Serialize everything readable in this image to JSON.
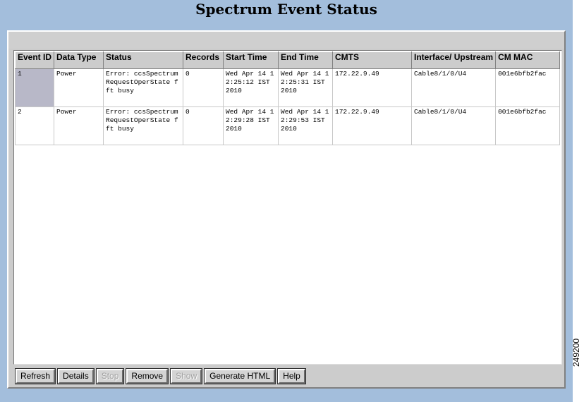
{
  "title": "Spectrum Event Status",
  "table": {
    "headers": [
      "Event ID",
      "Data Type",
      "Status",
      "Records",
      "Start Time",
      "End Time",
      "CMTS",
      "Interface/ Upstream",
      "CM MAC"
    ],
    "rows": [
      [
        "1",
        "Power",
        "Error: ccsSpectrumRequestOperState fft busy",
        "0",
        "Wed Apr 14 12:25:12 IST 2010",
        "Wed Apr 14 12:25:31 IST 2010",
        "172.22.9.49",
        "Cable8/1/0/U4",
        "001e6bfb2fac"
      ],
      [
        "2",
        "Power",
        "Error: ccsSpectrumRequestOperState fft busy",
        "0",
        "Wed Apr 14 12:29:28 IST 2010",
        "Wed Apr 14 12:29:53 IST 2010",
        "172.22.9.49",
        "Cable8/1/0/U4",
        "001e6bfb2fac"
      ]
    ]
  },
  "buttons": {
    "refresh": "Refresh",
    "details": "Details",
    "stop": "Stop",
    "remove": "Remove",
    "show": "Show",
    "generate_html": "Generate HTML",
    "help": "Help"
  },
  "figure_number": "249200",
  "colors": {
    "frame_background": "#a3bedc",
    "panel_background": "#cccccc",
    "selected_cell": "#b8b8c8"
  }
}
